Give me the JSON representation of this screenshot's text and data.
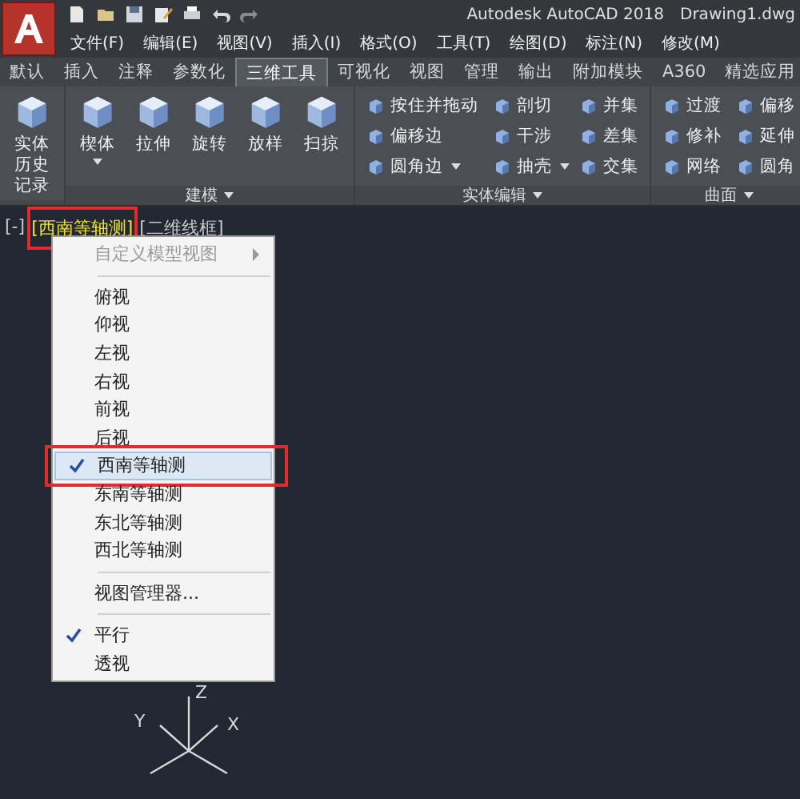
{
  "title_bar": {
    "title": "Autodesk AutoCAD 2018",
    "document": "Drawing1.dwg"
  },
  "menu_bar": [
    "文件(F)",
    "编辑(E)",
    "视图(V)",
    "插入(I)",
    "格式(O)",
    "工具(T)",
    "绘图(D)",
    "标注(N)",
    "修改(M)"
  ],
  "ribbon_tabs": [
    {
      "label": "默认",
      "selected": false
    },
    {
      "label": "插入",
      "selected": false
    },
    {
      "label": "注释",
      "selected": false
    },
    {
      "label": "参数化",
      "selected": false
    },
    {
      "label": "三维工具",
      "selected": true
    },
    {
      "label": "可视化",
      "selected": false
    },
    {
      "label": "视图",
      "selected": false
    },
    {
      "label": "管理",
      "selected": false
    },
    {
      "label": "输出",
      "selected": false
    },
    {
      "label": "附加模块",
      "selected": false
    },
    {
      "label": "A360",
      "selected": false
    },
    {
      "label": "精选应用",
      "selected": false
    }
  ],
  "ribbon_panels": [
    {
      "kind": "large",
      "buttons": [
        {
          "lines": [
            "实体",
            "历史记录"
          ],
          "dropdown": false
        }
      ]
    },
    {
      "kind": "large",
      "title": "建模",
      "buttons": [
        {
          "lines": [
            "楔体"
          ],
          "dropdown": true
        },
        {
          "lines": [
            "拉伸"
          ],
          "dropdown": false
        },
        {
          "lines": [
            "旋转"
          ],
          "dropdown": false
        },
        {
          "lines": [
            "放样"
          ],
          "dropdown": false
        },
        {
          "lines": [
            "扫掠"
          ],
          "dropdown": false
        }
      ]
    },
    {
      "kind": "small",
      "title": "实体编辑",
      "columns": [
        [
          {
            "label": "按住并拖动",
            "dropdown": false
          },
          {
            "label": "偏移边",
            "dropdown": false
          },
          {
            "label": "圆角边",
            "dropdown": true
          }
        ],
        [
          {
            "label": "剖切",
            "dropdown": false
          },
          {
            "label": "干涉",
            "dropdown": false
          },
          {
            "label": "抽壳",
            "dropdown": true
          }
        ],
        [
          {
            "label": "并集",
            "dropdown": false
          },
          {
            "label": "差集",
            "dropdown": false
          },
          {
            "label": "交集",
            "dropdown": false
          }
        ]
      ]
    },
    {
      "kind": "small",
      "title": "曲面",
      "columns": [
        [
          {
            "label": "过渡",
            "dropdown": false
          },
          {
            "label": "修补",
            "dropdown": false
          },
          {
            "label": "网络",
            "dropdown": false
          }
        ],
        [
          {
            "label": "偏移",
            "dropdown": false
          },
          {
            "label": "延伸",
            "dropdown": false
          },
          {
            "label": "圆角",
            "dropdown": false
          }
        ]
      ]
    }
  ],
  "viewport_controls": [
    {
      "label": "[-]",
      "highlighted": false,
      "annotated": false
    },
    {
      "label": "[西南等轴测]",
      "highlighted": true,
      "annotated": true
    },
    {
      "label": "[二维线框]",
      "highlighted": false,
      "annotated": false
    }
  ],
  "context_menu": {
    "items": [
      {
        "kind": "submenu",
        "label": "自定义模型视图",
        "disabled": true,
        "checked": false,
        "selected": false,
        "annotated": false
      },
      {
        "kind": "separator"
      },
      {
        "kind": "item",
        "label": "俯视",
        "disabled": false,
        "checked": false,
        "selected": false,
        "annotated": false
      },
      {
        "kind": "item",
        "label": "仰视",
        "disabled": false,
        "checked": false,
        "selected": false,
        "annotated": false
      },
      {
        "kind": "item",
        "label": "左视",
        "disabled": false,
        "checked": false,
        "selected": false,
        "annotated": false
      },
      {
        "kind": "item",
        "label": "右视",
        "disabled": false,
        "checked": false,
        "selected": false,
        "annotated": false
      },
      {
        "kind": "item",
        "label": "前视",
        "disabled": false,
        "checked": false,
        "selected": false,
        "annotated": false
      },
      {
        "kind": "item",
        "label": "后视",
        "disabled": false,
        "checked": false,
        "selected": false,
        "annotated": false
      },
      {
        "kind": "item",
        "label": "西南等轴测",
        "disabled": false,
        "checked": true,
        "selected": true,
        "annotated": true
      },
      {
        "kind": "item",
        "label": "东南等轴测",
        "disabled": false,
        "checked": false,
        "selected": false,
        "annotated": false
      },
      {
        "kind": "item",
        "label": "东北等轴测",
        "disabled": false,
        "checked": false,
        "selected": false,
        "annotated": false
      },
      {
        "kind": "item",
        "label": "西北等轴测",
        "disabled": false,
        "checked": false,
        "selected": false,
        "annotated": false
      },
      {
        "kind": "separator"
      },
      {
        "kind": "item",
        "label": "视图管理器...",
        "disabled": false,
        "checked": false,
        "selected": false,
        "annotated": false
      },
      {
        "kind": "separator"
      },
      {
        "kind": "item",
        "label": "平行",
        "disabled": false,
        "checked": true,
        "selected": false,
        "annotated": false
      },
      {
        "kind": "item",
        "label": "透视",
        "disabled": false,
        "checked": false,
        "selected": false,
        "annotated": false
      }
    ]
  },
  "ucs_icon": {
    "y_label": "Y",
    "z_label": "Z",
    "x_label": "X"
  }
}
